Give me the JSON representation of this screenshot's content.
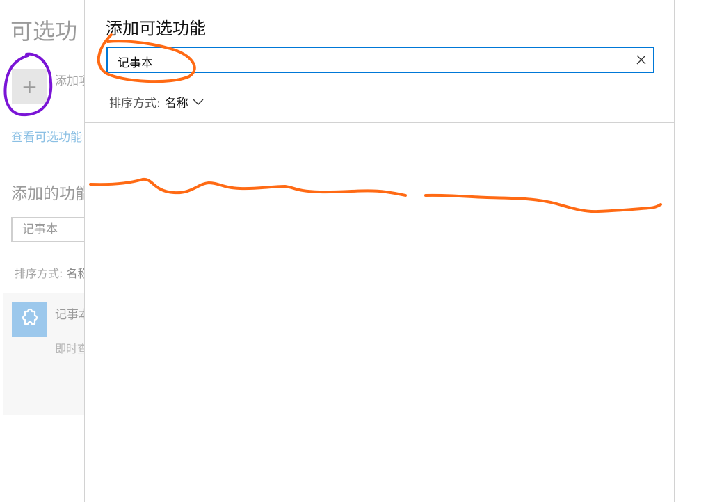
{
  "background": {
    "title": "可选功",
    "add_label": "添加项",
    "view_link": "查看可选功能",
    "heading": "添加的功能",
    "search_value": "记事本",
    "sort_label": "排序方式: ",
    "sort_value": "名称",
    "card_name": "记事本",
    "card_status": "即时查"
  },
  "dialog": {
    "title": "添加可选功能",
    "search_value": "记事本",
    "sort_label": "排序方式:",
    "sort_value": "名称"
  },
  "icons": {
    "add": "plus-icon",
    "feature": "puzzle-piece-icon",
    "clear": "close-icon",
    "sort_toggle": "chevron-down-icon"
  },
  "colors": {
    "accent": "#0078d7",
    "link": "#8cc0e4",
    "annotation_orange": "#ff6a14",
    "annotation_purple": "#7a14d6"
  }
}
